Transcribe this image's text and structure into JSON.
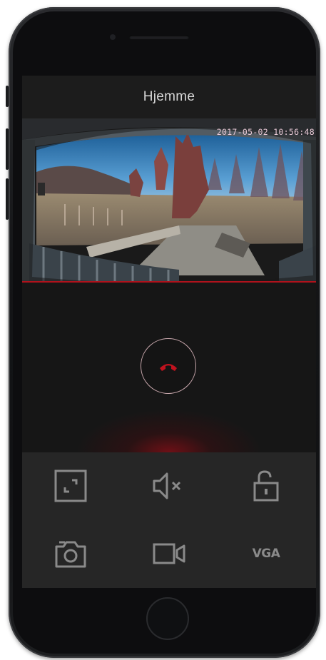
{
  "header": {
    "title": "Hjemme"
  },
  "video": {
    "timestamp": "2017-05-02 10:56:48"
  },
  "call": {
    "hangup_icon": "phone-hangup-icon",
    "accent_color": "#c0121e"
  },
  "controls": {
    "row1": [
      {
        "icon": "fullscreen-icon"
      },
      {
        "icon": "speaker-muted-icon"
      },
      {
        "icon": "unlock-icon"
      }
    ],
    "row2": [
      {
        "icon": "camera-snapshot-icon"
      },
      {
        "icon": "video-record-icon"
      },
      {
        "label": "VGA"
      }
    ]
  },
  "colors": {
    "icon_gray": "#8a8a8a",
    "underline_red": "#b0121c"
  }
}
